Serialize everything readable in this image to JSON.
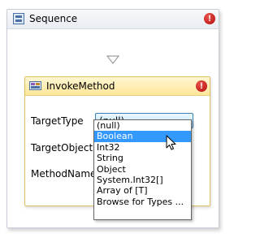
{
  "sequence": {
    "title": "Sequence",
    "icon": "sequence-activity-icon",
    "error_badge": "!"
  },
  "invoke_method": {
    "title": "InvokeMethod",
    "icon": "invoke-method-activity-icon",
    "error_badge": "!",
    "properties": {
      "target_type_label": "TargetType",
      "target_object_label": "TargetObject",
      "method_name_label": "MethodName"
    },
    "target_type_combo": {
      "value": "(null)"
    }
  },
  "dropdown": {
    "options": [
      "(null)",
      "Boolean",
      "Int32",
      "String",
      "Object",
      "System.Int32[]",
      "Array of [T]",
      "Browse for Types ..."
    ],
    "highlighted": "Boolean"
  },
  "colors": {
    "selection": "#3399ff",
    "activity_header": "#fde79a",
    "error": "#c62020",
    "combo_border": "#3c7fb1"
  }
}
